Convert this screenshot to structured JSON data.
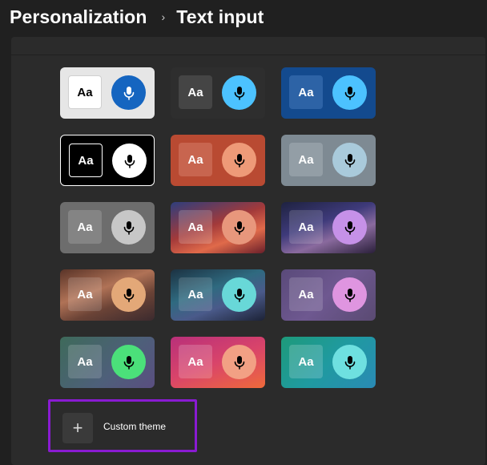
{
  "breadcrumb": {
    "parent": "Personalization",
    "separator": "›",
    "current": "Text input"
  },
  "theme_tile": {
    "aa_text": "Aa",
    "mic_icon": "microphone-icon"
  },
  "custom_theme": {
    "label": "Custom theme",
    "icon": "+"
  },
  "themes": [
    {
      "id": "light",
      "bg": "#e6e6e6",
      "aa_bg": "#ffffff",
      "aa_fg": "#000000",
      "aa_border": "#d0d0d0",
      "mic_bg": "#1565c0",
      "mic_fg": "#ffffff"
    },
    {
      "id": "dark",
      "bg": "#2e2e2e",
      "aa_bg": "#454545",
      "aa_fg": "#ffffff",
      "aa_border": "#454545",
      "mic_bg": "#4cc2ff",
      "mic_fg": "#000000"
    },
    {
      "id": "blue",
      "bg": "#134a8e",
      "aa_bg": "#2d63a6",
      "aa_fg": "#ffffff",
      "aa_border": "#2d63a6",
      "mic_bg": "#4cc2ff",
      "mic_fg": "#000000"
    },
    {
      "id": "high-contrast",
      "bg": "#000000",
      "aa_bg": "#000000",
      "aa_fg": "#ffffff",
      "aa_border": "#ffffff",
      "mic_bg": "#ffffff",
      "mic_fg": "#000000",
      "tile_border": "#ffffff"
    },
    {
      "id": "rust",
      "bg": "#b94a32",
      "aa_bg": "#c8654f",
      "aa_fg": "#ffffff",
      "aa_border": "#c8654f",
      "mic_bg": "#ee9a78",
      "mic_fg": "#000000"
    },
    {
      "id": "slate",
      "bg": "#7e8a93",
      "aa_bg": "#939ea6",
      "aa_fg": "#ffffff",
      "aa_border": "#939ea6",
      "mic_bg": "#a9cadb",
      "mic_fg": "#000000"
    },
    {
      "id": "gray",
      "bg": "#6d6d6d",
      "aa_bg": "#848484",
      "aa_fg": "#ffffff",
      "aa_border": "#848484",
      "mic_bg": "#c7c7c7",
      "mic_fg": "#000000"
    },
    {
      "id": "sunset",
      "bg": "linear-gradient(160deg,#2e3e7d 0%,#a33a3a 45%,#e06a4a 70%,#6a1f2a 100%)",
      "aa_bg": "rgba(255,255,255,0.18)",
      "aa_fg": "#ffffff",
      "aa_border": "transparent",
      "mic_bg": "#e8977c",
      "mic_fg": "#000000"
    },
    {
      "id": "violet-flow",
      "bg": "linear-gradient(160deg,#1e2240 0%,#3e3a7a 40%,#8a6a9e 65%,#2a1f3a 100%)",
      "aa_bg": "rgba(255,255,255,0.15)",
      "aa_fg": "#ffffff",
      "aa_border": "transparent",
      "mic_bg": "#c691e8",
      "mic_fg": "#000000"
    },
    {
      "id": "copper-flow",
      "bg": "linear-gradient(160deg,#5a3428 0%,#b07256 40%,#6b4336 65%,#3b2a2e 100%)",
      "aa_bg": "rgba(255,255,255,0.15)",
      "aa_fg": "#ffffff",
      "aa_border": "transparent",
      "mic_bg": "#e3a878",
      "mic_fg": "#000000"
    },
    {
      "id": "teal-flow",
      "bg": "linear-gradient(160deg,#1c3242 0%,#2f6a80 40%,#4a5a8a 65%,#1c2236 100%)",
      "aa_bg": "rgba(255,255,255,0.14)",
      "aa_fg": "#ffffff",
      "aa_border": "transparent",
      "mic_bg": "#68d8d8",
      "mic_fg": "#000000"
    },
    {
      "id": "lavender",
      "bg": "linear-gradient(135deg,#5a4a7a 0%,#6e5890 50%,#5a4a72 100%)",
      "aa_bg": "rgba(255,255,255,0.16)",
      "aa_fg": "#ffffff",
      "aa_border": "transparent",
      "mic_bg": "#df95e0",
      "mic_fg": "#000000"
    },
    {
      "id": "mint",
      "bg": "linear-gradient(135deg,#3e6a5a 0%,#4e5f7a 60%,#5a4e80 100%)",
      "aa_bg": "rgba(255,255,255,0.16)",
      "aa_fg": "#ffffff",
      "aa_border": "transparent",
      "mic_bg": "#4be07a",
      "mic_fg": "#000000"
    },
    {
      "id": "pink-orange",
      "bg": "linear-gradient(160deg,#b8307a 0%,#d9446a 50%,#ef6a3a 100%)",
      "aa_bg": "rgba(255,255,255,0.18)",
      "aa_fg": "#ffffff",
      "aa_border": "transparent",
      "mic_bg": "#f2a084",
      "mic_fg": "#000000"
    },
    {
      "id": "teal",
      "bg": "linear-gradient(135deg,#1e9a7a 0%,#1f9aa0 50%,#2a8ab5 100%)",
      "aa_bg": "rgba(255,255,255,0.18)",
      "aa_fg": "#ffffff",
      "aa_border": "transparent",
      "mic_bg": "#6ee0e0",
      "mic_fg": "#000000"
    }
  ]
}
